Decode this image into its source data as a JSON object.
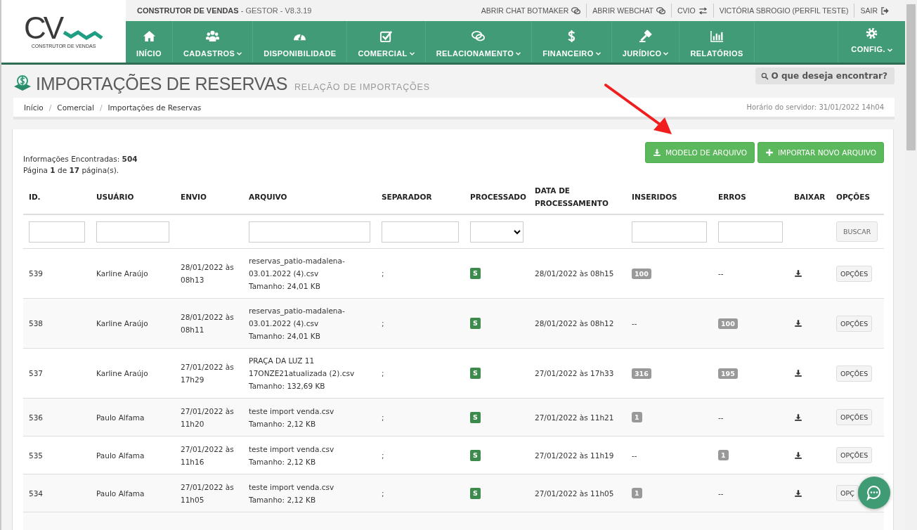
{
  "header": {
    "logo_mark": "CV",
    "logo_caption": "CONSTRUTOR DE VENDAS",
    "app_title": "**CONSTRUTOR DE VENDAS** - GESTOR - V8.3.19",
    "top_links": [
      {
        "label": "ABRIR CHAT BOTMAKER",
        "kind": "chat"
      },
      {
        "label": "ABRIR WEBCHAT",
        "kind": "chat"
      },
      {
        "label": "CVIO",
        "kind": "swap"
      },
      {
        "label": "VICTÓRIA SBROGIO (PERFIL TESTE)",
        "kind": "plain"
      },
      {
        "label": "SAIR",
        "kind": "logout"
      }
    ],
    "nav": [
      {
        "label": "INÍCIO",
        "kind": "home",
        "dropdown": false
      },
      {
        "label": "CADASTROS",
        "kind": "users",
        "dropdown": true
      },
      {
        "label": "DISPONIBILIDADE",
        "kind": "gauge",
        "dropdown": false
      },
      {
        "label": "COMERCIAL",
        "kind": "checkbox",
        "dropdown": true
      },
      {
        "label": "RELACIONAMENTO",
        "kind": "chat",
        "dropdown": true
      },
      {
        "label": "FINANCEIRO",
        "kind": "dollar",
        "dropdown": true
      },
      {
        "label": "JURÍDICO",
        "kind": "gavel",
        "dropdown": true
      },
      {
        "label": "RELATÓRIOS",
        "kind": "chart",
        "dropdown": false
      }
    ],
    "config": {
      "label": "CONFIG.",
      "kind": "gear",
      "dropdown": true
    }
  },
  "page": {
    "title": "IMPORTAÇÕES DE RESERVAS",
    "subtitle": "RELAÇÃO DE IMPORTAÇÕES",
    "search_button": "O que deseja encontrar?",
    "breadcrumb": [
      {
        "label": "Início",
        "separator": "/"
      },
      {
        "label": "Comercial",
        "separator": "/"
      },
      {
        "label": "Importações de Reservas"
      }
    ],
    "server_time": "Horário do servidor: 31/01/2022 14h04"
  },
  "panel": {
    "found": "Informações Encontradas: **504**",
    "pages": "Página **1** de **17** página(s).",
    "buttons": [
      {
        "label": "MODELO DE ARQUIVO",
        "kind": "download"
      },
      {
        "label": "IMPORTAR NOVO ARQUIVO",
        "kind": "plus"
      }
    ],
    "table": {
      "columns": [
        "ID.",
        "USUÁRIO",
        "ENVIO",
        "ARQUIVO",
        "SEPARADOR",
        "PROCESSADO",
        "DATA DE PROCESSAMENTO",
        "INSERIDOS",
        "ERROS",
        "BAIXAR",
        "OPÇÕES"
      ],
      "filters": [
        {
          "kind": "input"
        },
        {
          "kind": "input"
        },
        {
          "kind": "none"
        },
        {
          "kind": "input"
        },
        {
          "kind": "input"
        },
        {
          "kind": "select"
        },
        {
          "kind": "none"
        },
        {
          "kind": "input"
        },
        {
          "kind": "input"
        },
        {
          "kind": "none"
        },
        {
          "kind": "button",
          "label": "BUSCAR"
        }
      ],
      "rows": [
        {
          "id": "539",
          "user": "Karline Araújo",
          "sent": "28/01/2022 às 08h13",
          "file": "reservas_patio-madalena-03.01.2022 (4).csv",
          "size": "Tamanho: 24,01 KB",
          "separator": ";",
          "processed": "S",
          "processed_at": "28/01/2022 às 08h15",
          "inserted": {
            "text": "100",
            "kind": "badge"
          },
          "errors": {
            "text": "--",
            "kind": "plain"
          },
          "options": "OPÇÕES"
        },
        {
          "id": "538",
          "user": "Karline Araújo",
          "sent": "28/01/2022 às 08h11",
          "file": "reservas_patio-madalena-03.01.2022 (4).csv",
          "size": "Tamanho: 24,01 KB",
          "separator": ";",
          "processed": "S",
          "processed_at": "28/01/2022 às 08h12",
          "inserted": {
            "text": "--",
            "kind": "plain"
          },
          "errors": {
            "text": "100",
            "kind": "badge"
          },
          "options": "OPÇÕES"
        },
        {
          "id": "537",
          "user": "Karline Araújo",
          "sent": "27/01/2022 às 17h29",
          "file": "PRAÇA DA LUZ 11 17ONZE21atualizada (2).csv",
          "size": "Tamanho: 132,69 KB",
          "separator": ";",
          "processed": "S",
          "processed_at": "27/01/2022 às 17h33",
          "inserted": {
            "text": "316",
            "kind": "badge"
          },
          "errors": {
            "text": "195",
            "kind": "badge"
          },
          "options": "OPÇÕES"
        },
        {
          "id": "536",
          "user": "Paulo Alfama",
          "sent": "27/01/2022 às 11h20",
          "file": "teste import venda.csv",
          "size": "Tamanho: 2,12 KB",
          "separator": ";",
          "processed": "S",
          "processed_at": "27/01/2022 às 11h21",
          "inserted": {
            "text": "1",
            "kind": "badge"
          },
          "errors": {
            "text": "--",
            "kind": "plain"
          },
          "options": "OPÇÕES"
        },
        {
          "id": "535",
          "user": "Paulo Alfama",
          "sent": "27/01/2022 às 11h16",
          "file": "teste import venda.csv",
          "size": "Tamanho: 2,12 KB",
          "separator": ";",
          "processed": "S",
          "processed_at": "27/01/2022 às 11h19",
          "inserted": {
            "text": "--",
            "kind": "plain"
          },
          "errors": {
            "text": "1",
            "kind": "badge"
          },
          "options": "OPÇÕES"
        },
        {
          "id": "534",
          "user": "Paulo Alfama",
          "sent": "27/01/2022 às 11h05",
          "file": "teste import venda.csv",
          "size": "Tamanho: 2,12 KB",
          "separator": ";",
          "processed": "S",
          "processed_at": "27/01/2022 às 11h05",
          "inserted": {
            "text": "1",
            "kind": "badge"
          },
          "errors": {
            "text": "--",
            "kind": "plain"
          },
          "options": "OPÇ"
        }
      ]
    }
  }
}
